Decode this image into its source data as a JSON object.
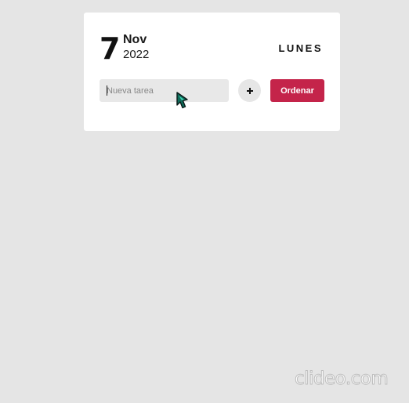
{
  "date": {
    "day": "7",
    "month": "Nov",
    "year": "2022",
    "weekday": "LUNES"
  },
  "task_form": {
    "placeholder": "Nueva tarea",
    "value": "",
    "add_button_icon": "plus-icon",
    "sort_label": "Ordenar"
  },
  "watermark": {
    "text": "clideo.com"
  },
  "colors": {
    "background": "#e5e5e5",
    "card": "#ffffff",
    "accent": "#c4244a",
    "input_bg": "#e8e8e8"
  }
}
